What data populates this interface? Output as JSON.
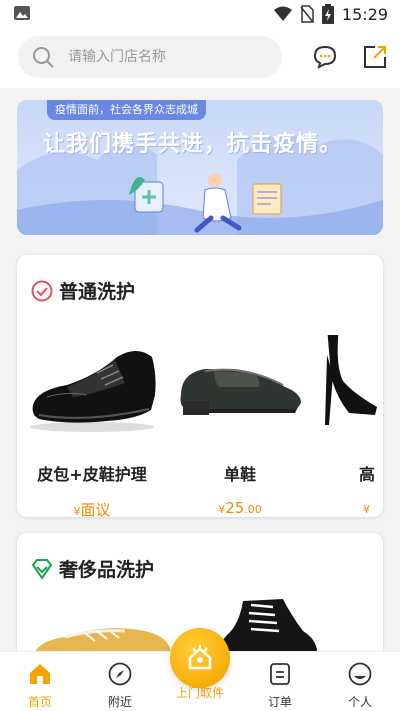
{
  "status_bar": {
    "time": "15:29"
  },
  "search": {
    "placeholder": "请输入门店名称",
    "value": ""
  },
  "banner": {
    "tag": "疫情面前，社会各界众志成城",
    "title": "让我们携手共进，抗击疫情。"
  },
  "sections": [
    {
      "title": "普通洗护",
      "icon": "clock-icon",
      "accent": "#e8505b",
      "products": [
        {
          "name": "皮包+皮鞋护理",
          "currency": "¥",
          "price": "面议",
          "price_dec": ""
        },
        {
          "name": "单鞋",
          "currency": "¥",
          "price": "25",
          "price_dec": ".00"
        },
        {
          "name": "高",
          "currency": "¥",
          "price": "",
          "price_dec": ""
        }
      ]
    },
    {
      "title": "奢侈品洗护",
      "icon": "diamond-icon",
      "accent": "#1aa34a"
    }
  ],
  "tabbar": {
    "items": [
      {
        "label": "首页",
        "icon": "home-icon"
      },
      {
        "label": "附近",
        "icon": "compass-icon"
      },
      {
        "label": "上门取件",
        "icon": "pickup-icon"
      },
      {
        "label": "订单",
        "icon": "order-icon"
      },
      {
        "label": "个人",
        "icon": "profile-icon"
      }
    ]
  },
  "colors": {
    "accent": "#f5a300",
    "price": "#f08a00"
  }
}
